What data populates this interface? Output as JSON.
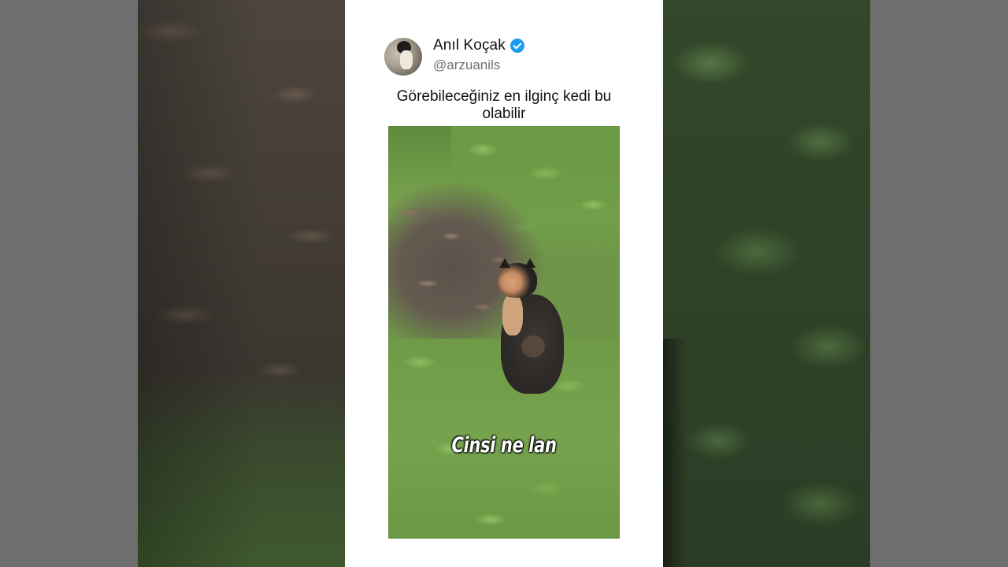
{
  "post": {
    "author_name": "Anıl Koçak",
    "handle": "@arzuanils",
    "caption": "Görebileceğiniz en ilginç kedi bu olabilir",
    "video_subtitle": "Cinsi ne lan"
  },
  "icons": {
    "verified": "verified-badge-icon"
  },
  "colors": {
    "verified_badge": "#1d9bf0",
    "card_background": "#ffffff",
    "handle_text": "#6f6f6f"
  }
}
